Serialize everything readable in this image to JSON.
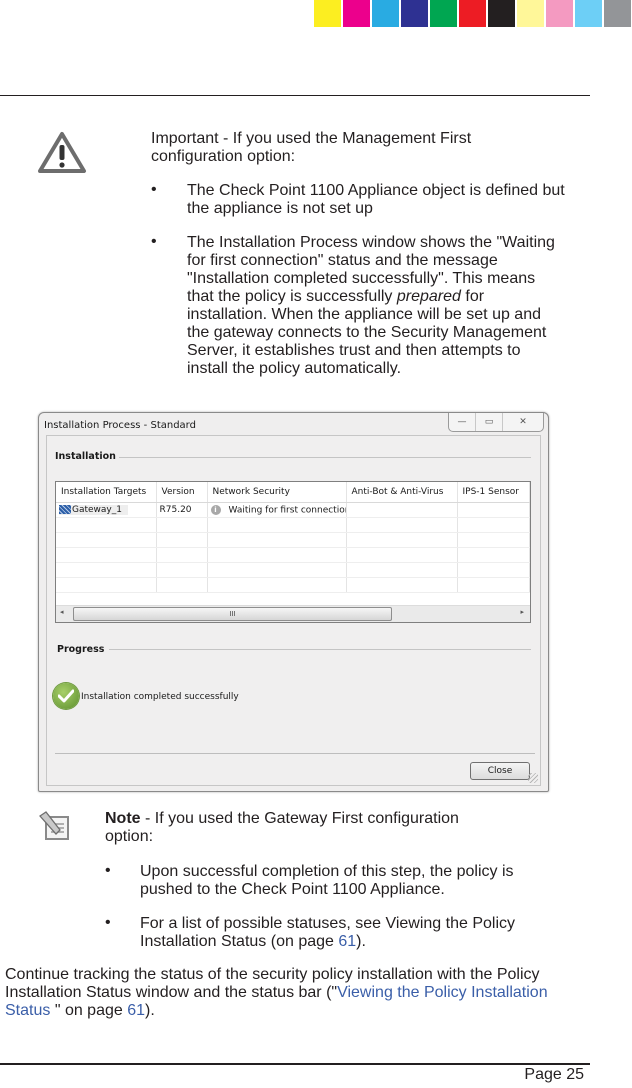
{
  "print_marks": {
    "color_swatches": [
      "#fcee21",
      "#ec008c",
      "#29abe2",
      "#2e3192",
      "#00a651",
      "#ed1c24",
      "#231f20",
      "#fff799",
      "#f49ac1",
      "#6dcff6",
      "#939598"
    ]
  },
  "important": {
    "icon": "warning-triangle-icon",
    "intro": "Important - If you used the Management First configuration option:",
    "bullet_1": "The Check Point 1100 Appliance object is defined but the appliance is not set up",
    "bullet_2_part1": "The Installation Process window shows the \"Waiting for first connection\" status and the message \"Installation completed successfully\". This means that the policy is successfully ",
    "bullet_2_em": "prepared",
    "bullet_2_part2": " for installation. When the appliance will be set up and the gateway connects to the Security Management Server, it establishes trust and then attempts to install the policy automatically."
  },
  "dialog": {
    "title": "Installation Process  - Standard",
    "window_buttons": {
      "minimize": "—",
      "maximize": "▭",
      "close": "✕"
    },
    "installation_group": "Installation",
    "columns": [
      "Installation Targets",
      "Version",
      "Network Security",
      "Anti-Bot & Anti-Virus",
      "IPS-1 Sensor"
    ],
    "rows": [
      {
        "target": "Gateway_1",
        "version": "R75.20",
        "network_security": "Waiting for first connection",
        "anti_bot": "",
        "ips": ""
      }
    ],
    "scroll_thumb_grip": "III",
    "scroll_left": "◂",
    "scroll_right": "▸",
    "progress_group": "Progress",
    "progress_message": "Installation completed successfully",
    "close_button": "Close"
  },
  "note": {
    "icon": "note-pencil-icon",
    "label": "Note",
    "intro_rest": " - If you used the Gateway First configuration option:",
    "bullet_1": "Upon successful completion of this step, the policy is pushed to the Check Point 1100 Appliance.",
    "bullet_2_text": "For a list of possible statuses, see Viewing the Policy Installation Status (on page ",
    "bullet_2_page": "61",
    "bullet_2_end": ")."
  },
  "paragraph": {
    "text": "Continue tracking the status of the security policy installation with the Policy Installation Status window and the status bar (\"",
    "link": "Viewing the Policy Installation Status ",
    "mid": "\" on page ",
    "page": "61",
    "end": ")."
  },
  "footer": {
    "page_label": "Page 25"
  },
  "bullet_char": "•"
}
